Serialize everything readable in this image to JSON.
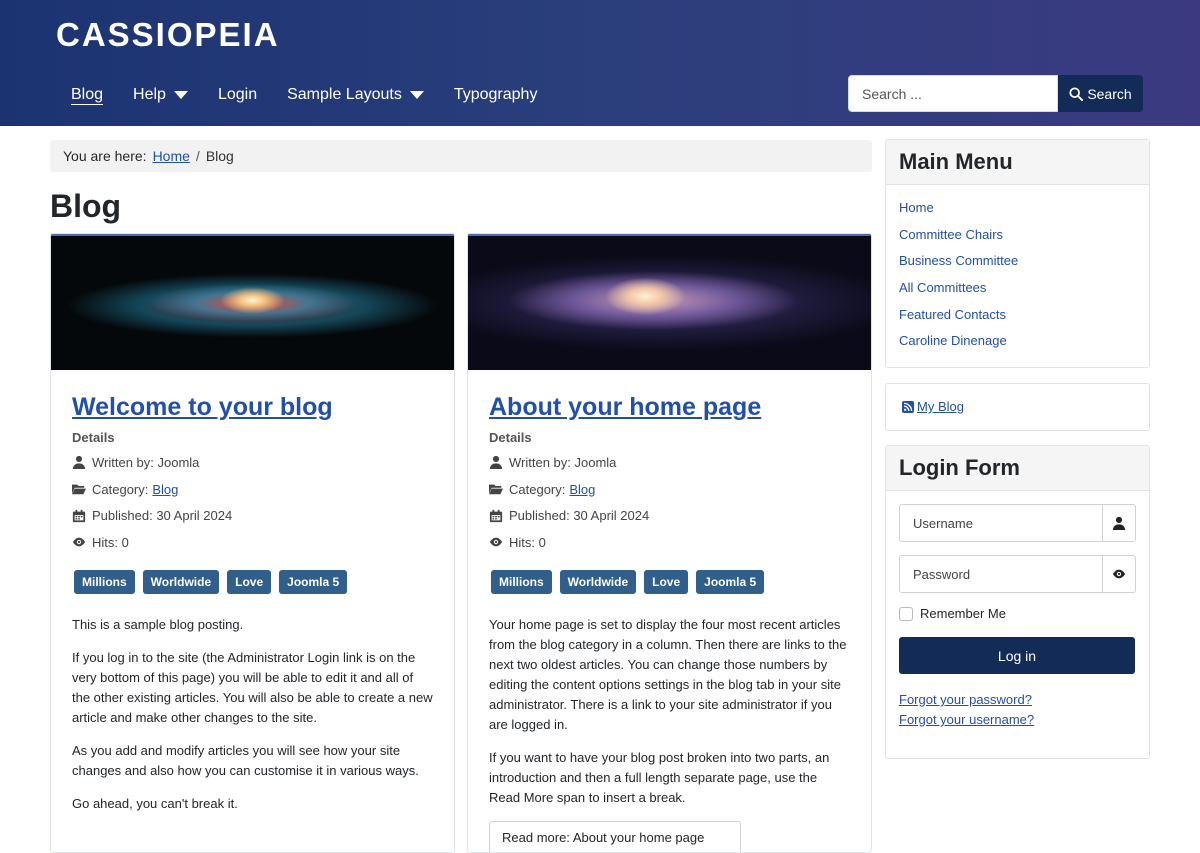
{
  "brand": "CASSIOPEIA",
  "nav": {
    "items": [
      {
        "label": "Blog"
      },
      {
        "label": "Help"
      },
      {
        "label": "Login"
      },
      {
        "label": "Sample Layouts"
      },
      {
        "label": "Typography"
      }
    ]
  },
  "search": {
    "placeholder": "Search ...",
    "button_label": "Search"
  },
  "breadcrumb": {
    "prefix": "You are here:",
    "home": "Home",
    "separator": "/",
    "current": "Blog"
  },
  "page_title": "Blog",
  "articles": [
    {
      "title": "Welcome to your blog",
      "details_label": "Details",
      "written_by": "Written by: Joomla",
      "category_prefix": "Category:",
      "category": "Blog",
      "published": "Published: 30 April 2024",
      "hits": "Hits: 0",
      "tags": [
        "Millions",
        "Worldwide",
        "Love",
        "Joomla 5"
      ],
      "paragraphs": [
        "This is a sample blog posting.",
        "If you log in to the site (the Administrator Login link is on the very bottom of this page) you will be able to edit it and all of the other existing articles. You will also be able to create a new article and make other changes to the site.",
        "As you add and modify articles you will see how your site changes and also how you can customise it in various ways.",
        "Go ahead, you can't break it."
      ]
    },
    {
      "title": "About your home page",
      "details_label": "Details",
      "written_by": "Written by: Joomla",
      "category_prefix": "Category:",
      "category": "Blog",
      "published": "Published: 30 April 2024",
      "hits": "Hits: 0",
      "tags": [
        "Millions",
        "Worldwide",
        "Love",
        "Joomla 5"
      ],
      "paragraphs": [
        "Your home page is set to display the four most recent articles from the blog category in a column. Then there are links to the next two oldest articles. You can change those numbers by editing the content options settings in the blog tab in your site administrator. There is a link to your site administrator if you are logged in.",
        "If you want to have your blog post broken into two parts, an introduction and then a full length separate page, use the Read More span to insert a break."
      ],
      "read_more": "Read more: About your home page"
    }
  ],
  "main_menu": {
    "title": "Main Menu",
    "items": [
      "Home",
      "Committee Chairs",
      "Business Committee",
      "All Committees",
      "Featured Contacts",
      "Caroline Dinenage"
    ]
  },
  "feed": {
    "label": "My Blog"
  },
  "login_form": {
    "title": "Login Form",
    "username_placeholder": "Username",
    "password_placeholder": "Password",
    "remember_label": "Remember Me",
    "login_button": "Log in",
    "forgot_password": "Forgot your password?",
    "forgot_username": "Forgot your username?"
  },
  "colors": {
    "header_start": "#1c3372",
    "header_end": "#3b3a80",
    "link": "#224faa",
    "tag_bg": "#2f5f8a",
    "button_dark": "#132b57"
  }
}
